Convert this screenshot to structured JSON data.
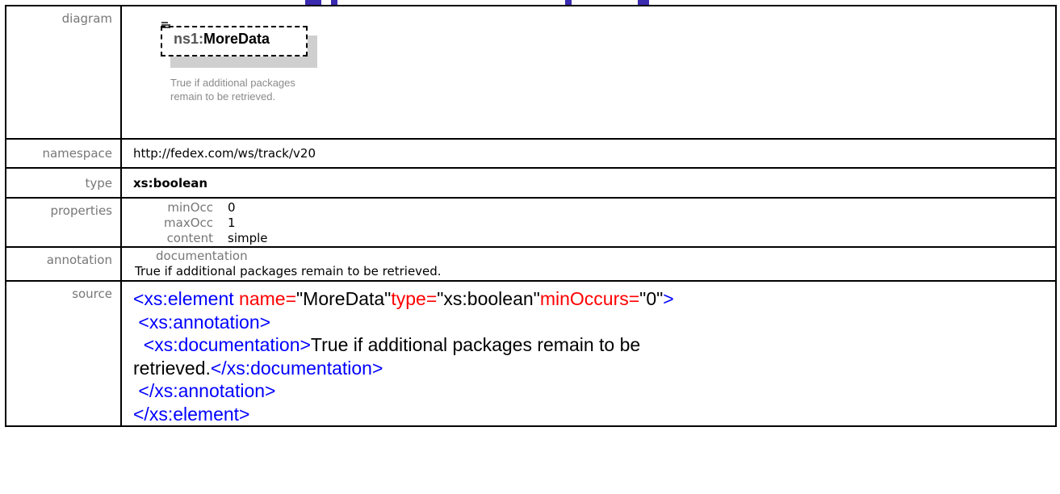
{
  "labels": {
    "diagram": "diagram",
    "namespace": "namespace",
    "type": "type",
    "properties": "properties",
    "annotation": "annotation",
    "source": "source"
  },
  "diagram": {
    "prefix": "ns1:",
    "name": "MoreData",
    "description_line1": "True if additional packages",
    "description_line2": "remain to be retrieved."
  },
  "namespace": "http://fedex.com/ws/track/v20",
  "type": "xs:boolean",
  "properties": [
    {
      "key": "minOcc",
      "value": "0"
    },
    {
      "key": "maxOcc",
      "value": "1"
    },
    {
      "key": "content",
      "value": "simple"
    }
  ],
  "annotation": {
    "key": "documentation",
    "text": "True if additional  packages remain to be retrieved."
  },
  "source": {
    "l1_open": "<xs:element",
    "l1_name_attr": "name=",
    "l1_name_val": "\"MoreData\"",
    "l1_type_attr": "type=",
    "l1_type_val": "\"xs:boolean\"",
    "l1_min_attr": "minOccurs=",
    "l1_min_val": "\"0\"",
    "l1_close": ">",
    "l2": "<xs:annotation>",
    "l3_open": "<xs:documentation>",
    "l3_text": "True if additional packages remain to be",
    "l4_text": "retrieved.",
    "l4_close": "</xs:documentation>",
    "l5": "</xs:annotation>",
    "l6": "</xs:element>"
  },
  "colors": {
    "tag": "#8b1a1a",
    "bracket": "#0000ff",
    "attribute": "#ff0000",
    "label": "#777777"
  }
}
